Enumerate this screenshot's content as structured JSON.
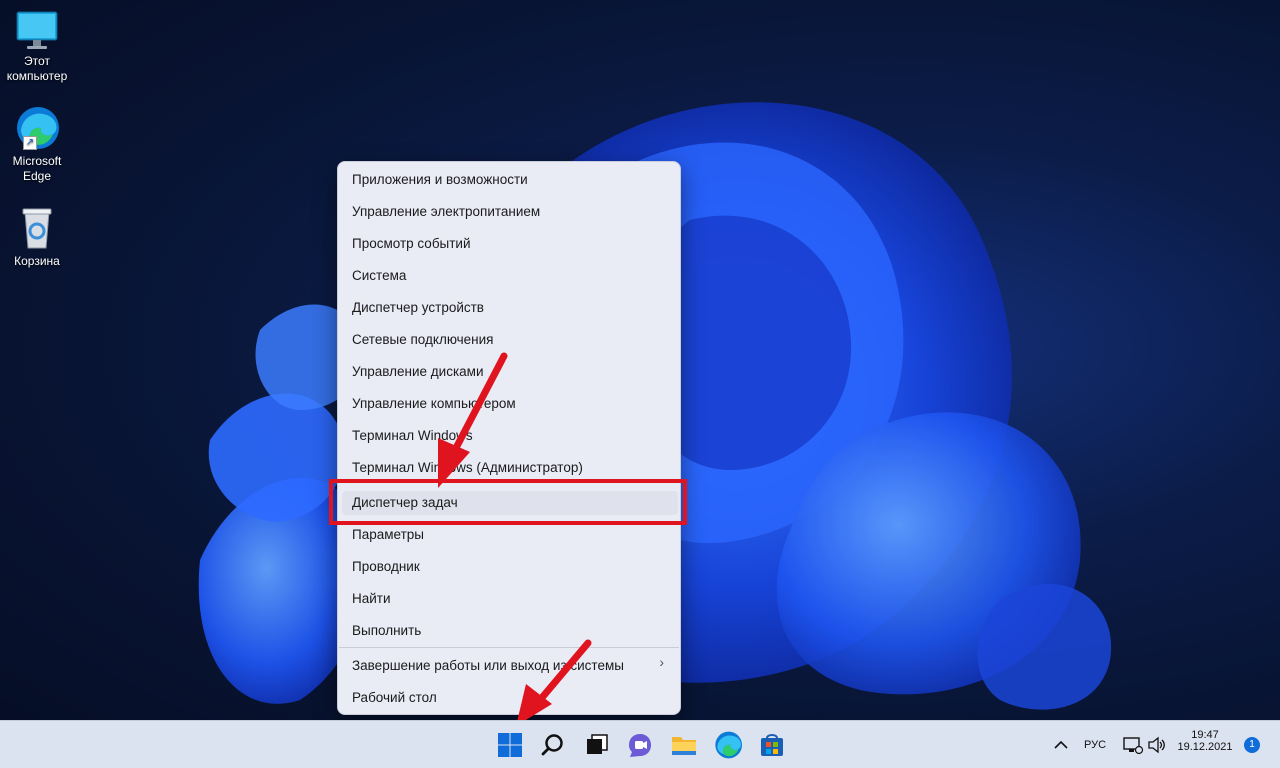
{
  "desktop": {
    "icons": [
      {
        "label_line1": "Этот",
        "label_line2": "компьютер"
      },
      {
        "label_line1": "Microsoft",
        "label_line2": "Edge"
      },
      {
        "label_line1": "Корзина",
        "label_line2": ""
      }
    ]
  },
  "context_menu": {
    "items": [
      "Приложения и возможности",
      "Управление электропитанием",
      "Просмотр событий",
      "Система",
      "Диспетчер устройств",
      "Сетевые подключения",
      "Управление дисками",
      "Управление компьютером",
      "Терминал Windows",
      "Терминал Windows (Администратор)",
      "Диспетчер задач",
      "Параметры",
      "Проводник",
      "Найти",
      "Выполнить",
      "Завершение работы или выход из системы",
      "Рабочий стол"
    ],
    "highlighted_item": "Диспетчер задач",
    "submenu_chevron": "›"
  },
  "taskbar": {
    "icons": [
      "start-icon",
      "search-icon",
      "task-view-icon",
      "chat-icon",
      "file-explorer-icon",
      "edge-icon",
      "store-icon"
    ],
    "tray": {
      "language": "РУС",
      "time": "19:47",
      "date": "19.12.2021",
      "notification_count": "1"
    }
  },
  "colors": {
    "annotation_red": "#e0141e",
    "menu_bg": "#e9ebf5",
    "taskbar_bg": "#dce3f0"
  }
}
